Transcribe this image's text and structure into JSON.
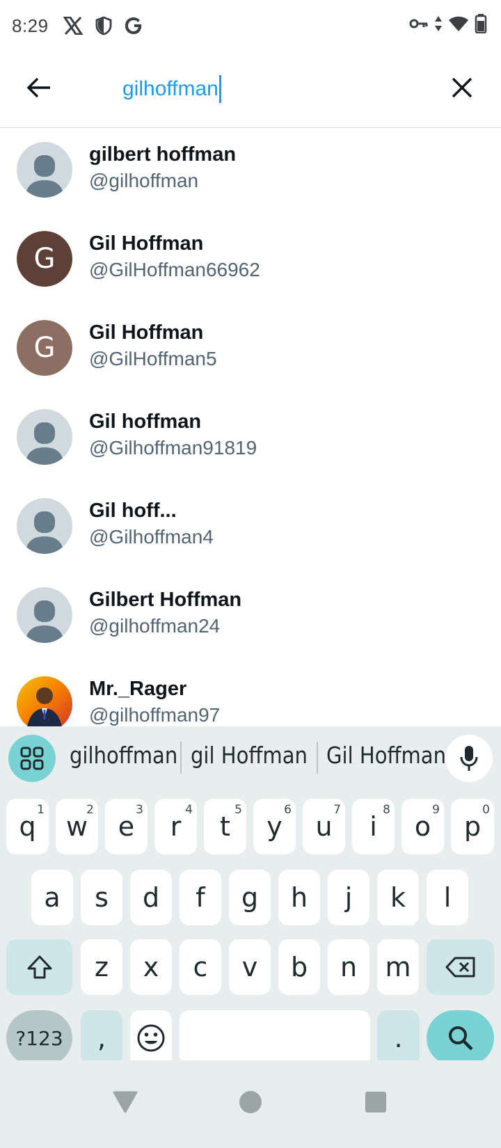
{
  "status_bar": {
    "time": "8:29",
    "icons": [
      "x-logo-icon",
      "shield-icon",
      "google-icon"
    ],
    "right_icons": [
      "vpn-key-icon",
      "data-arrows-icon",
      "wifi-icon",
      "battery-icon"
    ]
  },
  "search": {
    "value": "gilhoffman",
    "accent_color": "#1d9bf0"
  },
  "results": [
    {
      "name": "gilbert hoffman",
      "handle": "@gilhoffman",
      "avatar": "default",
      "avatar_letter": ""
    },
    {
      "name": "Gil Hoffman",
      "handle": "@GilHoffman66962",
      "avatar": "letter",
      "avatar_letter": "G",
      "avatar_color": "#5d4037"
    },
    {
      "name": "Gil Hoffman",
      "handle": "@GilHoffman5",
      "avatar": "letter",
      "avatar_letter": "G",
      "avatar_color": "#8d6e63"
    },
    {
      "name": "Gil hoffman",
      "handle": "@Gilhoffman91819",
      "avatar": "default",
      "avatar_letter": ""
    },
    {
      "name": "Gil hoff...",
      "handle": "@Gilhoffman4",
      "avatar": "default",
      "avatar_letter": ""
    },
    {
      "name": "Gilbert Hoffman",
      "handle": "@gilhoffman24",
      "avatar": "default",
      "avatar_letter": ""
    },
    {
      "name": "Mr._Rager",
      "handle": "@gilhoffman97",
      "avatar": "photo",
      "avatar_letter": ""
    }
  ],
  "keyboard": {
    "suggestions": [
      "gilhoffman",
      "gil Hoffman",
      "Gil Hoffman"
    ],
    "row1": [
      {
        "key": "q",
        "hint": "1"
      },
      {
        "key": "w",
        "hint": "2"
      },
      {
        "key": "e",
        "hint": "3"
      },
      {
        "key": "r",
        "hint": "4"
      },
      {
        "key": "t",
        "hint": "5"
      },
      {
        "key": "y",
        "hint": "6"
      },
      {
        "key": "u",
        "hint": "7"
      },
      {
        "key": "i",
        "hint": "8"
      },
      {
        "key": "o",
        "hint": "9"
      },
      {
        "key": "p",
        "hint": "0"
      }
    ],
    "row2": [
      "a",
      "s",
      "d",
      "f",
      "g",
      "h",
      "j",
      "k",
      "l"
    ],
    "row3": [
      "z",
      "x",
      "c",
      "v",
      "b",
      "n",
      "m"
    ],
    "symbols_label": "?123",
    "comma": ",",
    "period": "."
  }
}
